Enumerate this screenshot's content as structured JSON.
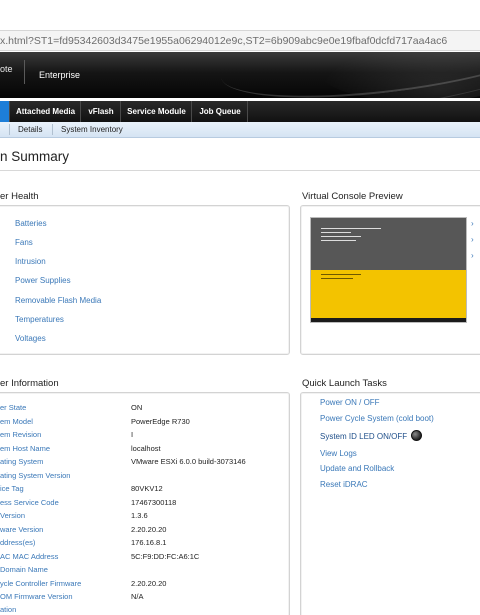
{
  "browser": {
    "url": "x.html?ST1=fd95342603d3475e1955a06294012e9c,ST2=6b909abc9e0e19fbaf0dcfd717aa4ac6"
  },
  "banner": {
    "brand": "ote",
    "edition": "Enterprise"
  },
  "tabs": [
    {
      "label": ""
    },
    {
      "label": "Attached Media"
    },
    {
      "label": "vFlash"
    },
    {
      "label": "Service Module"
    },
    {
      "label": "Job Queue"
    }
  ],
  "subtabs": [
    {
      "label": "Details"
    },
    {
      "label": "System Inventory"
    }
  ],
  "page": {
    "title": "n Summary"
  },
  "health": {
    "title": "er Health",
    "items": [
      "Batteries",
      "Fans",
      "Intrusion",
      "Power Supplies",
      "Removable Flash Media",
      "Temperatures",
      "Voltages"
    ]
  },
  "console_preview": {
    "title": "Virtual Console Preview",
    "colors": {
      "top": "#575757",
      "bottom": "#f3c300"
    }
  },
  "server_info": {
    "title": "er Information",
    "rows": [
      {
        "label": "er State",
        "value": "ON"
      },
      {
        "label": "em Model",
        "value": "PowerEdge R730"
      },
      {
        "label": "em Revision",
        "value": "I"
      },
      {
        "label": "em Host Name",
        "value": "localhost"
      },
      {
        "label": "ating System",
        "value": "VMware ESXi 6.0.0 build-3073146"
      },
      {
        "label": "ating System Version",
        "value": ""
      },
      {
        "label": "ice Tag",
        "value": "80VKV12"
      },
      {
        "label": "ess Service Code",
        "value": "17467300118"
      },
      {
        "label": "Version",
        "value": "1.3.6"
      },
      {
        "label": "ware Version",
        "value": "2.20.20.20"
      },
      {
        "label": "ddress(es)",
        "value": "176.16.8.1"
      },
      {
        "label": "AC MAC Address",
        "value": "5C:F9:DD:FC:A6:1C"
      },
      {
        "label": "Domain Name",
        "value": ""
      },
      {
        "label": "ycle Controller Firmware",
        "value": "2.20.20.20"
      },
      {
        "label": "OM Firmware Version",
        "value": "N/A"
      },
      {
        "label": "ation",
        "value": ""
      }
    ]
  },
  "quick_launch": {
    "title": "Quick Launch Tasks",
    "items": [
      "Power ON / OFF",
      "Power Cycle System (cold boot)",
      "System ID LED ON/OFF",
      "View Logs",
      "Update and Rollback",
      "Reset iDRAC"
    ]
  },
  "colors": {
    "link": "#3a78b8",
    "active_tab": "#1d7ed8"
  }
}
